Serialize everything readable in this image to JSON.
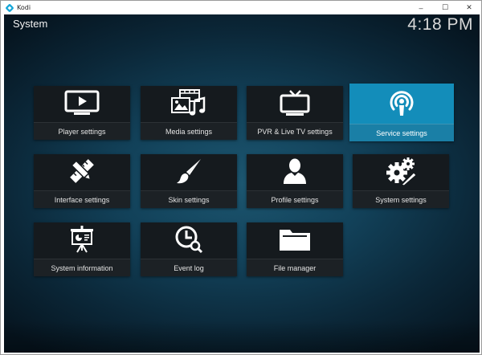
{
  "window": {
    "title": "Kodi",
    "controls": {
      "minimize": "–",
      "maximize": "☐",
      "close": "✕"
    }
  },
  "screen": {
    "title": "System",
    "clock": "4:18 PM"
  },
  "colors": {
    "focus": "#138dba",
    "tile": "#151a1e",
    "background": "#124159"
  },
  "tiles": [
    {
      "label": "Player settings",
      "icon": "monitor-play-icon"
    },
    {
      "label": "Media settings",
      "icon": "media-icon"
    },
    {
      "label": "PVR & Live TV settings",
      "icon": "tv-icon"
    },
    {
      "label": "Service settings",
      "icon": "podcast-icon",
      "focused": true
    },
    {
      "label": "Interface settings",
      "icon": "pencil-ruler-icon"
    },
    {
      "label": "Skin settings",
      "icon": "paintbrush-icon"
    },
    {
      "label": "Profile settings",
      "icon": "user-icon"
    },
    {
      "label": "System settings",
      "icon": "gears-icon"
    },
    {
      "label": "System information",
      "icon": "presentation-icon"
    },
    {
      "label": "Event log",
      "icon": "clock-search-icon"
    },
    {
      "label": "File manager",
      "icon": "folder-icon"
    }
  ]
}
